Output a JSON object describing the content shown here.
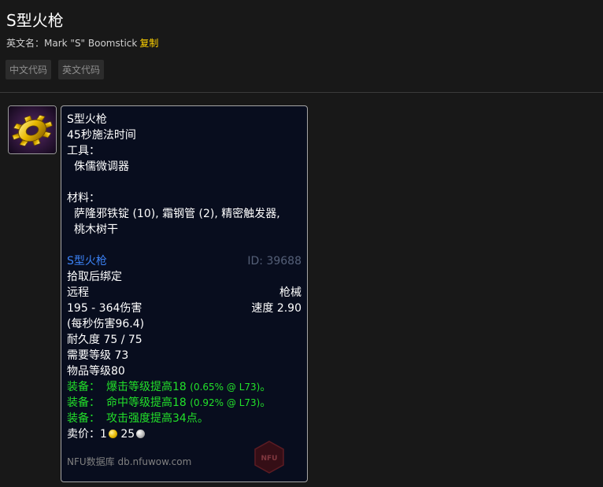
{
  "page": {
    "title": "S型火枪",
    "en_label": "英文名：",
    "en_name": "Mark \"S\" Boomstick",
    "copy_label": "复制",
    "tabs": [
      "中文代码",
      "英文代码"
    ]
  },
  "item": {
    "icon": "gear-icon",
    "recipe_name": "S型火枪",
    "cast_time": "45秒施法时间",
    "tools_label": "工具：",
    "tool": "侏儒微调器",
    "materials_label": "材料：",
    "materials_line1": "萨隆邪铁锭 (10), 霜钢管 (2), 精密触发器,",
    "materials_line2": "桃木树干",
    "name": "S型火枪",
    "id": "ID: 39688",
    "binding": "拾取后绑定",
    "slot": "远程",
    "type": "枪械",
    "damage": "195 - 364伤害",
    "speed": "速度 2.90",
    "dps": "(每秒伤害96.4)",
    "durability": "耐久度 75 / 75",
    "req_level": "需要等级 73",
    "item_level": "物品等级80",
    "equip_label": "装备：",
    "effects": [
      {
        "text": "爆击等级提高18",
        "pct": "(0.65% @ L73)",
        "end": "。"
      },
      {
        "text": "命中等级提高18",
        "pct": "(0.92% @ L73)",
        "end": "。"
      },
      {
        "text": "攻击强度提高34点。",
        "pct": "",
        "end": ""
      }
    ],
    "sell_label": "卖价：",
    "sell_gold": "1",
    "sell_silver": "25",
    "footer": "NFU数据库 db.nfuwow.com",
    "watermark": "NFU"
  },
  "colors": {
    "item_name": "#3b82f6",
    "equip": "#22e02a",
    "copy": "#ffd200",
    "tooltip_bg": "#080d1e"
  }
}
